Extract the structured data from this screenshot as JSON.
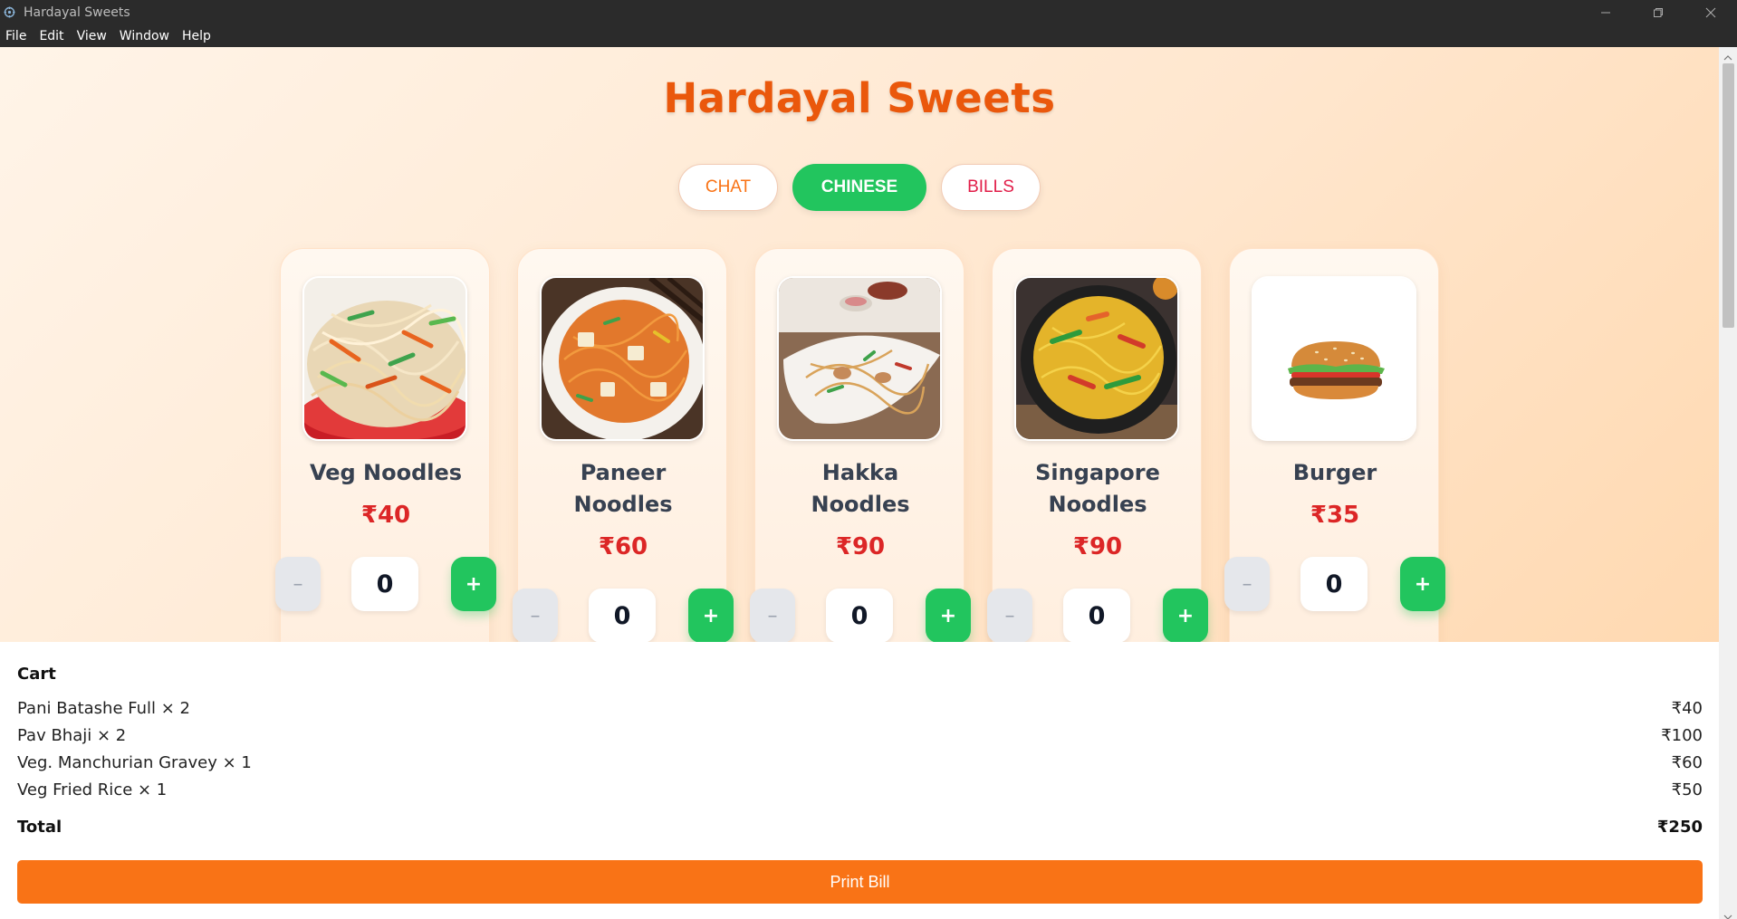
{
  "window": {
    "title": "Hardayal Sweets",
    "controls": [
      "minimize",
      "restore",
      "close"
    ]
  },
  "menu": {
    "items": [
      "File",
      "Edit",
      "View",
      "Window",
      "Help"
    ]
  },
  "page": {
    "title": "Hardayal Sweets"
  },
  "tabs": [
    {
      "label": "CHAT",
      "active": false
    },
    {
      "label": "CHINESE",
      "active": true
    },
    {
      "label": "BILLS",
      "active": false
    }
  ],
  "products": [
    {
      "name": "Veg Noodles",
      "price": "₹40",
      "qty": "0",
      "icon": "veg-noodles-image"
    },
    {
      "name": "Paneer Noodles",
      "price": "₹60",
      "qty": "0",
      "icon": "paneer-noodles-image"
    },
    {
      "name": "Hakka Noodles",
      "price": "₹90",
      "qty": "0",
      "icon": "hakka-noodles-image"
    },
    {
      "name": "Singapore Noodles",
      "price": "₹90",
      "qty": "0",
      "icon": "singapore-noodles-image"
    },
    {
      "name": "Burger",
      "price": "₹35",
      "qty": "0",
      "icon": "burger-image"
    }
  ],
  "qty_controls": {
    "minus": "–",
    "plus": "+"
  },
  "cart": {
    "title": "Cart",
    "items": [
      {
        "name": "Pani Batashe Full × 2",
        "price": "₹40"
      },
      {
        "name": "Pav Bhaji × 2",
        "price": "₹100"
      },
      {
        "name": "Veg. Manchurian Gravey × 1",
        "price": "₹60"
      },
      {
        "name": "Veg Fried Rice × 1",
        "price": "₹50"
      }
    ],
    "total_label": "Total",
    "total_value": "₹250",
    "print_label": "Print Bill"
  },
  "colors": {
    "accent_orange": "#f97316",
    "title_orange": "#ea580c",
    "active_green": "#22c55e",
    "price_red": "#dc2626"
  }
}
